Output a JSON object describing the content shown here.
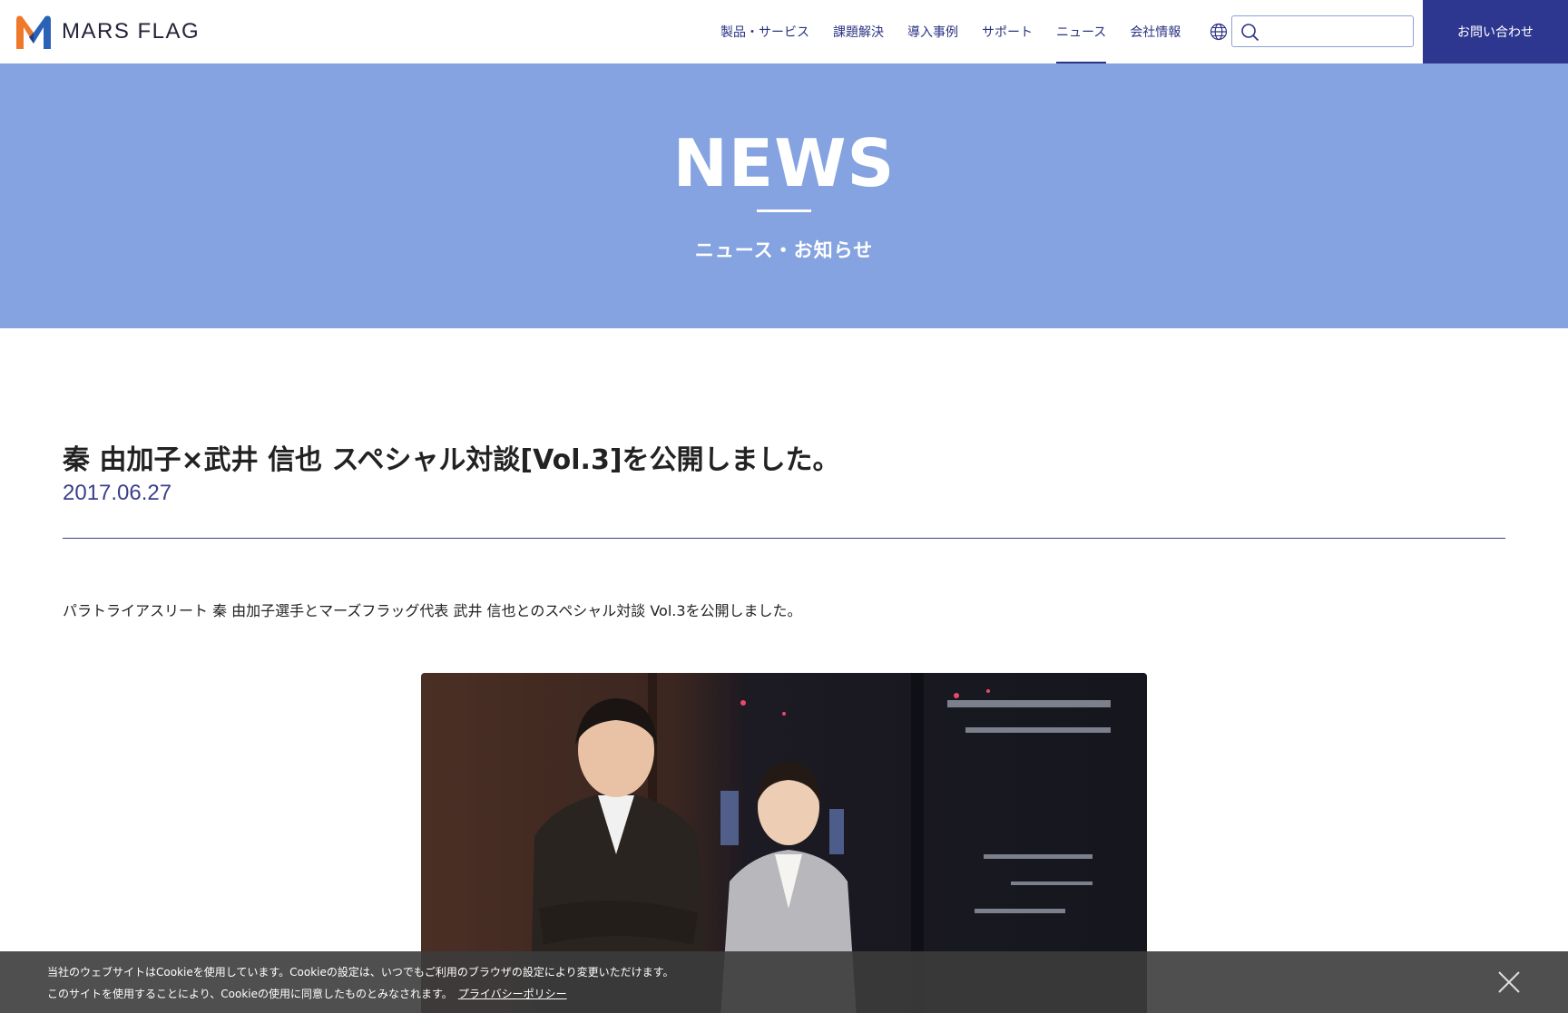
{
  "brand": {
    "name": "MARS FLAG"
  },
  "nav": {
    "items": [
      {
        "label": "製品・サービス"
      },
      {
        "label": "課題解決"
      },
      {
        "label": "導入事例"
      },
      {
        "label": "サポート"
      },
      {
        "label": "ニュース",
        "active": true
      },
      {
        "label": "会社情報"
      }
    ],
    "search_value": "",
    "contact_label": "お問い合わせ"
  },
  "hero": {
    "title": "NEWS",
    "subtitle": "ニュース・お知らせ"
  },
  "article": {
    "title": "秦 由加子×武井 信也 スペシャル対談[Vol.3]を公開しました。",
    "date": "2017.06.27",
    "body": "パラトライアスリート 秦 由加子選手とマーズフラッグ代表 武井 信也とのスペシャル対談 Vol.3を公開しました。"
  },
  "cookie": {
    "line1": "当社のウェブサイトはCookieを使用しています。Cookieの設定は、いつでもご利用のブラウザの設定により変更いただけます。",
    "line2": "このサイトを使用することにより、Cookieの使用に同意したものとみなされます。",
    "link_label": "プライバシーポリシー"
  },
  "colors": {
    "brand_navy": "#2e3790",
    "hero_blue": "#84a3e0",
    "logo_orange": "#f0782a",
    "logo_blue": "#2a62b8"
  }
}
